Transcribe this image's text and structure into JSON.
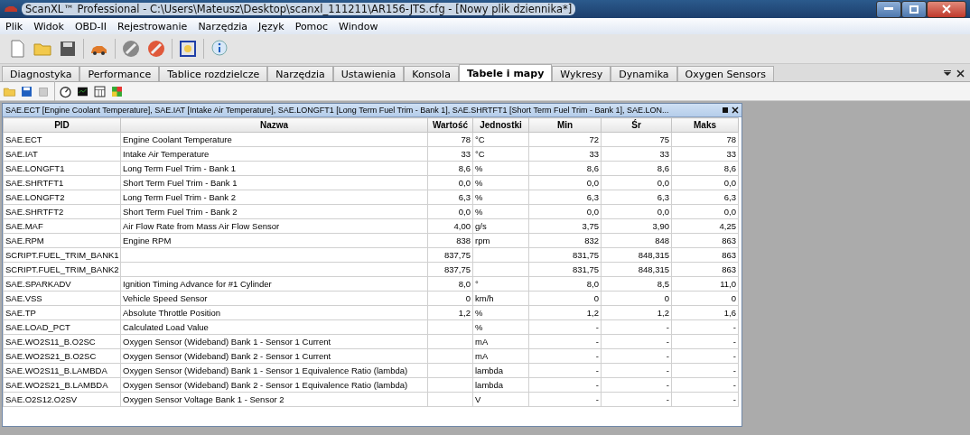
{
  "window": {
    "title": "ScanXL™ Professional - C:\\Users\\Mateusz\\Desktop\\scanxl_111211\\AR156-JTS.cfg - [Nowy plik dziennika*]"
  },
  "menu": [
    "Plik",
    "Widok",
    "OBD-II",
    "Rejestrowanie",
    "Narzędzia",
    "Język",
    "Pomoc",
    "Window"
  ],
  "tabs": [
    {
      "label": "Diagnostyka",
      "selected": false
    },
    {
      "label": "Performance",
      "selected": false
    },
    {
      "label": "Tablice rozdzielcze",
      "selected": false
    },
    {
      "label": "Narzędzia",
      "selected": false
    },
    {
      "label": "Ustawienia",
      "selected": false
    },
    {
      "label": "Konsola",
      "selected": false
    },
    {
      "label": "Tabele i mapy",
      "selected": true
    },
    {
      "label": "Wykresy",
      "selected": false
    },
    {
      "label": "Dynamika",
      "selected": false
    },
    {
      "label": "Oxygen Sensors",
      "selected": false
    }
  ],
  "panel": {
    "title": "SAE.ECT [Engine Coolant Temperature], SAE.IAT [Intake Air Temperature], SAE.LONGFT1 [Long Term Fuel Trim - Bank 1], SAE.SHRTFT1 [Short Term Fuel Trim - Bank 1], SAE.LON...",
    "table": {
      "columns": [
        "PID",
        "Nazwa",
        "Wartość",
        "Jednostki",
        "Min",
        "Śr",
        "Maks"
      ],
      "rows": [
        [
          "SAE.ECT",
          "Engine Coolant Temperature",
          "78",
          "°C",
          "72",
          "75",
          "78"
        ],
        [
          "SAE.IAT",
          "Intake Air Temperature",
          "33",
          "°C",
          "33",
          "33",
          "33"
        ],
        [
          "SAE.LONGFT1",
          "Long Term Fuel Trim - Bank 1",
          "8,6",
          "%",
          "8,6",
          "8,6",
          "8,6"
        ],
        [
          "SAE.SHRTFT1",
          "Short Term Fuel Trim - Bank 1",
          "0,0",
          "%",
          "0,0",
          "0,0",
          "0,0"
        ],
        [
          "SAE.LONGFT2",
          "Long Term Fuel Trim - Bank 2",
          "6,3",
          "%",
          "6,3",
          "6,3",
          "6,3"
        ],
        [
          "SAE.SHRTFT2",
          "Short Term Fuel Trim - Bank 2",
          "0,0",
          "%",
          "0,0",
          "0,0",
          "0,0"
        ],
        [
          "SAE.MAF",
          "Air Flow Rate from Mass Air Flow Sensor",
          "4,00",
          "g/s",
          "3,75",
          "3,90",
          "4,25"
        ],
        [
          "SAE.RPM",
          "Engine RPM",
          "838",
          "rpm",
          "832",
          "848",
          "863"
        ],
        [
          "SCRIPT.FUEL_TRIM_BANK1",
          "",
          "837,75",
          "",
          "831,75",
          "848,315",
          "863"
        ],
        [
          "SCRIPT.FUEL_TRIM_BANK2",
          "",
          "837,75",
          "",
          "831,75",
          "848,315",
          "863"
        ],
        [
          "SAE.SPARKADV",
          "Ignition Timing Advance for #1 Cylinder",
          "8,0",
          "°",
          "8,0",
          "8,5",
          "11,0"
        ],
        [
          "SAE.VSS",
          "Vehicle Speed Sensor",
          "0",
          "km/h",
          "0",
          "0",
          "0"
        ],
        [
          "SAE.TP",
          "Absolute Throttle Position",
          "1,2",
          "%",
          "1,2",
          "1,2",
          "1,6"
        ],
        [
          "SAE.LOAD_PCT",
          "Calculated Load Value",
          "",
          "%",
          "-",
          "-",
          "-"
        ],
        [
          "SAE.WO2S11_B.O2SC",
          "Oxygen Sensor (Wideband) Bank 1 - Sensor 1 Current",
          "",
          "mA",
          "-",
          "-",
          "-"
        ],
        [
          "SAE.WO2S21_B.O2SC",
          "Oxygen Sensor (Wideband) Bank 2 - Sensor 1 Current",
          "",
          "mA",
          "-",
          "-",
          "-"
        ],
        [
          "SAE.WO2S11_B.LAMBDA",
          "Oxygen Sensor (Wideband) Bank 1 - Sensor 1 Equivalence Ratio (lambda)",
          "",
          "lambda",
          "-",
          "-",
          "-"
        ],
        [
          "SAE.WO2S21_B.LAMBDA",
          "Oxygen Sensor (Wideband) Bank 2 - Sensor 1 Equivalence Ratio (lambda)",
          "",
          "lambda",
          "-",
          "-",
          "-"
        ],
        [
          "SAE.O2S12.O2SV",
          "Oxygen Sensor Voltage Bank 1 - Sensor 2",
          "",
          "V",
          "-",
          "-",
          "-"
        ]
      ]
    }
  }
}
